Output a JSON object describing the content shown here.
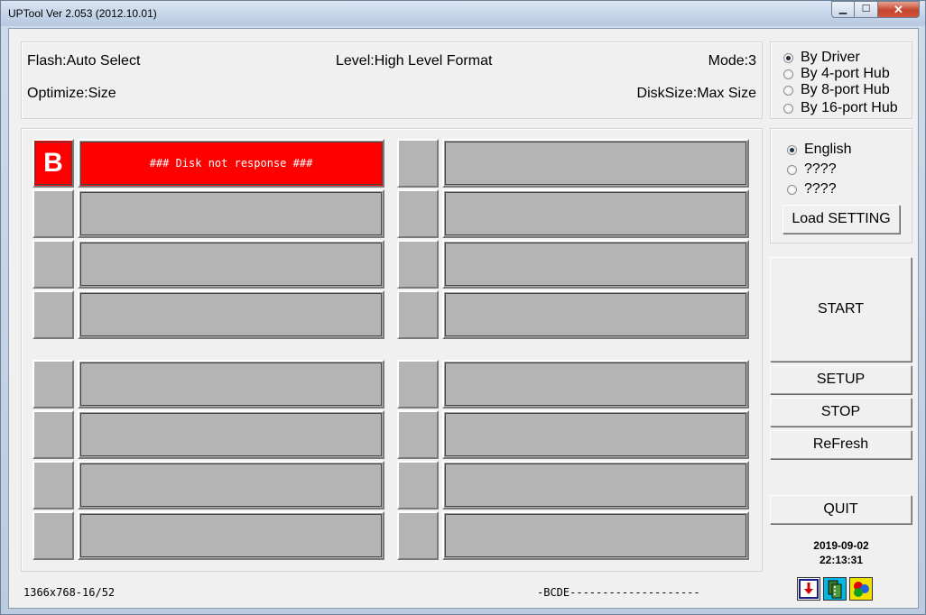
{
  "window": {
    "title": "UPTool Ver 2.053 (2012.10.01)",
    "minimize_glyph": "▁",
    "maximize_glyph": "☐",
    "close_glyph": "✕"
  },
  "info": {
    "flash": "Flash:Auto Select",
    "level": "Level:High Level Format",
    "mode": "Mode:3",
    "optimize": "Optimize:Size",
    "disk_size": "DiskSize:Max Size"
  },
  "hub_options": {
    "items": [
      {
        "label": "By Driver",
        "selected": true
      },
      {
        "label": "By 4-port Hub",
        "selected": false
      },
      {
        "label": "By 8-port Hub",
        "selected": false
      },
      {
        "label": "By 16-port Hub",
        "selected": false
      }
    ]
  },
  "language_options": {
    "items": [
      {
        "label": "English",
        "selected": true
      },
      {
        "label": "????",
        "selected": false
      },
      {
        "label": "????",
        "selected": false
      }
    ],
    "load_button": "Load SETTING"
  },
  "buttons": {
    "start": "START",
    "setup": "SETUP",
    "stop": "STOP",
    "refresh": "ReFresh",
    "quit": "QUIT"
  },
  "slots": {
    "active": {
      "drive_letter": "B",
      "message": "### Disk not response ###",
      "color": "#ff0000"
    }
  },
  "status": {
    "resolution": "1366x768-16/52",
    "drives": "-BCDE--------------------",
    "date": "2019-09-02",
    "time": "22:13:31"
  },
  "icons": [
    "download-icon",
    "film-icon",
    "color-circles-icon"
  ]
}
